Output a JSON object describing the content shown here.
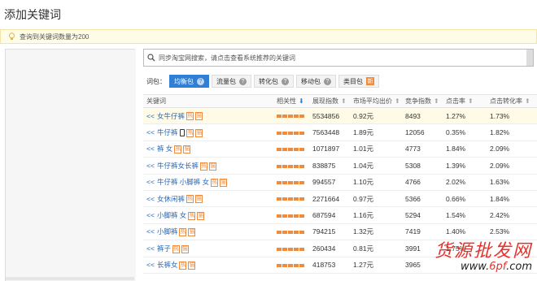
{
  "page": {
    "title": "添加关键词"
  },
  "notice": {
    "icon": "lightbulb-icon",
    "text": "查询到关键词数量为200"
  },
  "search": {
    "icon": "search-icon",
    "placeholder": "同步淘宝网搜索，请点击查看系统推荐的关键词"
  },
  "packages": {
    "label": "词包：",
    "tabs": [
      {
        "label": "均衡包",
        "active": true,
        "help": "?"
      },
      {
        "label": "流量包",
        "active": false,
        "help": "?"
      },
      {
        "label": "转化包",
        "active": false,
        "help": "?"
      },
      {
        "label": "移动包",
        "active": false,
        "help": "?"
      },
      {
        "label": "类目包",
        "active": false,
        "help": "?",
        "badge": "新"
      }
    ]
  },
  "table": {
    "headers": [
      "关键词",
      "相关性",
      "展现指数",
      "市场平均出价",
      "竞争指数",
      "点击率",
      "点击转化率"
    ],
    "rows": [
      {
        "prefix": "<<",
        "keyword": "女牛仔裤",
        "tags": [
          "热",
          "猫"
        ],
        "phone": false,
        "impressions": "5534856",
        "avg_bid": "0.92元",
        "competition": "8493",
        "ctr": "1.27%",
        "cvr": "1.73%"
      },
      {
        "prefix": "<<",
        "keyword": "牛仔裤",
        "tags": [
          "热",
          "猫"
        ],
        "phone": true,
        "impressions": "7563448",
        "avg_bid": "1.89元",
        "competition": "12056",
        "ctr": "0.35%",
        "cvr": "1.82%"
      },
      {
        "prefix": "<<",
        "keyword": "裤 女",
        "tags": [
          "热",
          "猫"
        ],
        "phone": false,
        "impressions": "1071897",
        "avg_bid": "1.01元",
        "competition": "4773",
        "ctr": "1.84%",
        "cvr": "2.09%"
      },
      {
        "prefix": "<<",
        "keyword": "牛仔裤女长裤",
        "tags": [
          "热",
          "猫"
        ],
        "phone": false,
        "impressions": "838875",
        "avg_bid": "1.04元",
        "competition": "5308",
        "ctr": "1.39%",
        "cvr": "2.09%"
      },
      {
        "prefix": "<<",
        "keyword": "牛仔裤 小脚裤 女",
        "tags": [
          "热",
          "猫"
        ],
        "phone": false,
        "impressions": "994557",
        "avg_bid": "1.10元",
        "competition": "4766",
        "ctr": "2.02%",
        "cvr": "1.63%"
      },
      {
        "prefix": "<<",
        "keyword": "女休闲裤",
        "tags": [
          "热",
          "猫"
        ],
        "phone": false,
        "impressions": "2271664",
        "avg_bid": "0.97元",
        "competition": "5366",
        "ctr": "0.66%",
        "cvr": "1.84%"
      },
      {
        "prefix": "<<",
        "keyword": "小脚裤 女",
        "tags": [
          "热",
          "猫"
        ],
        "phone": false,
        "impressions": "687594",
        "avg_bid": "1.16元",
        "competition": "5294",
        "ctr": "1.54%",
        "cvr": "2.42%"
      },
      {
        "prefix": "<<",
        "keyword": "小脚裤",
        "tags": [
          "热",
          "猫"
        ],
        "phone": false,
        "impressions": "794215",
        "avg_bid": "1.32元",
        "competition": "7419",
        "ctr": "1.40%",
        "cvr": "2.53%"
      },
      {
        "prefix": "<<",
        "keyword": "裤子",
        "tags": [
          "热",
          "猫"
        ],
        "phone": false,
        "impressions": "260434",
        "avg_bid": "0.81元",
        "competition": "3991",
        "ctr": "1.75%",
        "cvr": ""
      },
      {
        "prefix": "<<",
        "keyword": "长裤女",
        "tags": [
          "热",
          "猫"
        ],
        "phone": false,
        "impressions": "418753",
        "avg_bid": "1.27元",
        "competition": "3965",
        "ctr": "",
        "cvr": ""
      }
    ]
  },
  "watermark": {
    "main": "货源批发网",
    "sub_prefix": "www.",
    "sub_highlight": "6pf",
    "sub_suffix": ".com"
  },
  "colors": {
    "accent": "#2f7fd6",
    "tag": "#f08a3c",
    "link": "#2566b8",
    "watermark_red": "#e5322d"
  }
}
